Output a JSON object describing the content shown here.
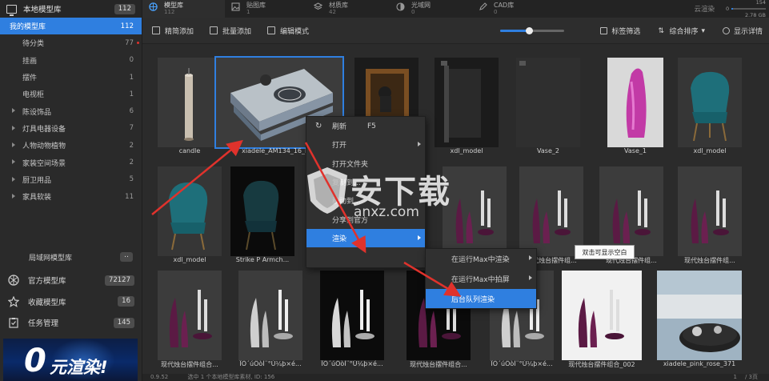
{
  "sidebar": {
    "local_lib": {
      "label": "本地模型库",
      "count": "112"
    },
    "my_lib": {
      "label": "我的模型库",
      "count": "112"
    },
    "subitems": [
      {
        "label": "待分类",
        "count": "77"
      },
      {
        "label": "挂画",
        "count": "0"
      },
      {
        "label": "摆件",
        "count": "1"
      },
      {
        "label": "电视柜",
        "count": "1"
      }
    ],
    "categories": [
      {
        "label": "陈设饰品",
        "count": "6"
      },
      {
        "label": "灯具电器设备",
        "count": "7"
      },
      {
        "label": "人物动物植物",
        "count": "2"
      },
      {
        "label": "家装空间场景",
        "count": "2"
      },
      {
        "label": "厨卫用品",
        "count": "5"
      },
      {
        "label": "家具软装",
        "count": "11"
      }
    ],
    "lan_lib": {
      "label": "局域网模型库",
      "pill": ".."
    },
    "bottom": [
      {
        "label": "官方模型库",
        "count": "72127"
      },
      {
        "label": "收藏模型库",
        "count": "16"
      },
      {
        "label": "任务管理",
        "count": "145"
      }
    ],
    "banner": {
      "big": "0",
      "text": "元渲染!"
    }
  },
  "tabs": [
    {
      "label": "模型库",
      "sub": "112"
    },
    {
      "label": "贴图库",
      "sub": "1"
    },
    {
      "label": "材质库",
      "sub": "42"
    },
    {
      "label": "光域网",
      "sub": "0"
    },
    {
      "label": "CAD库",
      "sub": "0"
    }
  ],
  "topbar": {
    "cloud": "云渲染",
    "storage_used": "154",
    "storage_zero": "0",
    "storage_total": "2.78 GB",
    "storage_fraction": 0.05
  },
  "toolbar": {
    "precise_add": "精简添加",
    "batch_add": "批量添加",
    "edit_mode": "编辑模式",
    "zoom_fraction": 0.45,
    "tag_filter": "标签筛选",
    "sort": "综合排序",
    "show_details": "显示详情"
  },
  "grid": {
    "row1": [
      "candle",
      "xiadele_AM134_16_boo",
      "",
      "xdl_model",
      "Vase_2",
      "Vase_1",
      "xdl_model"
    ],
    "row2": [
      "xdl_model",
      "Strike P Armch...",
      "",
      "",
      "现代烛台摆件组...",
      "现代烛台摆件组...",
      "现代烛台摆件组..."
    ],
    "row3": [
      "现代烛台摆件组合...",
      "ÏÖ´úÖòÌ¨°Ú¼þ×é...",
      "ÏÖ´úÖòÌ¨°Ú¼þ×é...",
      "现代烛台摆件组合...",
      "ÏÖ´úÖòÌ¨°Ú¼þ×é...",
      "现代烛台摆件组合_002",
      "xiadele_pink_rose_371"
    ]
  },
  "context_menu": {
    "items": [
      {
        "label": "刷新",
        "shortcut": "F5"
      },
      {
        "label": "打开",
        "shortcut": ""
      },
      {
        "label": "打开文件夹",
        "shortcut": ""
      },
      {
        "label": "复制到...",
        "shortcut": ""
      },
      {
        "label": "移动到...",
        "shortcut": ""
      },
      {
        "label": "分享到官方",
        "shortcut": ""
      },
      {
        "label": "渲染",
        "shortcut": ""
      }
    ]
  },
  "submenu": {
    "items": [
      "在运行Max中渲染",
      "在运行Max中拍屏",
      "后台队列渲染"
    ]
  },
  "tooltip": "双击可显示空白",
  "status": {
    "version": "0.9.52",
    "text": "选中 1 个本地模型库素材, ID: 156",
    "page": "1",
    "pages": "/ 3页"
  },
  "watermark": {
    "text": "安下载",
    "url": "anxz.com"
  },
  "colors": {
    "accent": "#2f7fe0",
    "arrow": "#e0322c"
  }
}
